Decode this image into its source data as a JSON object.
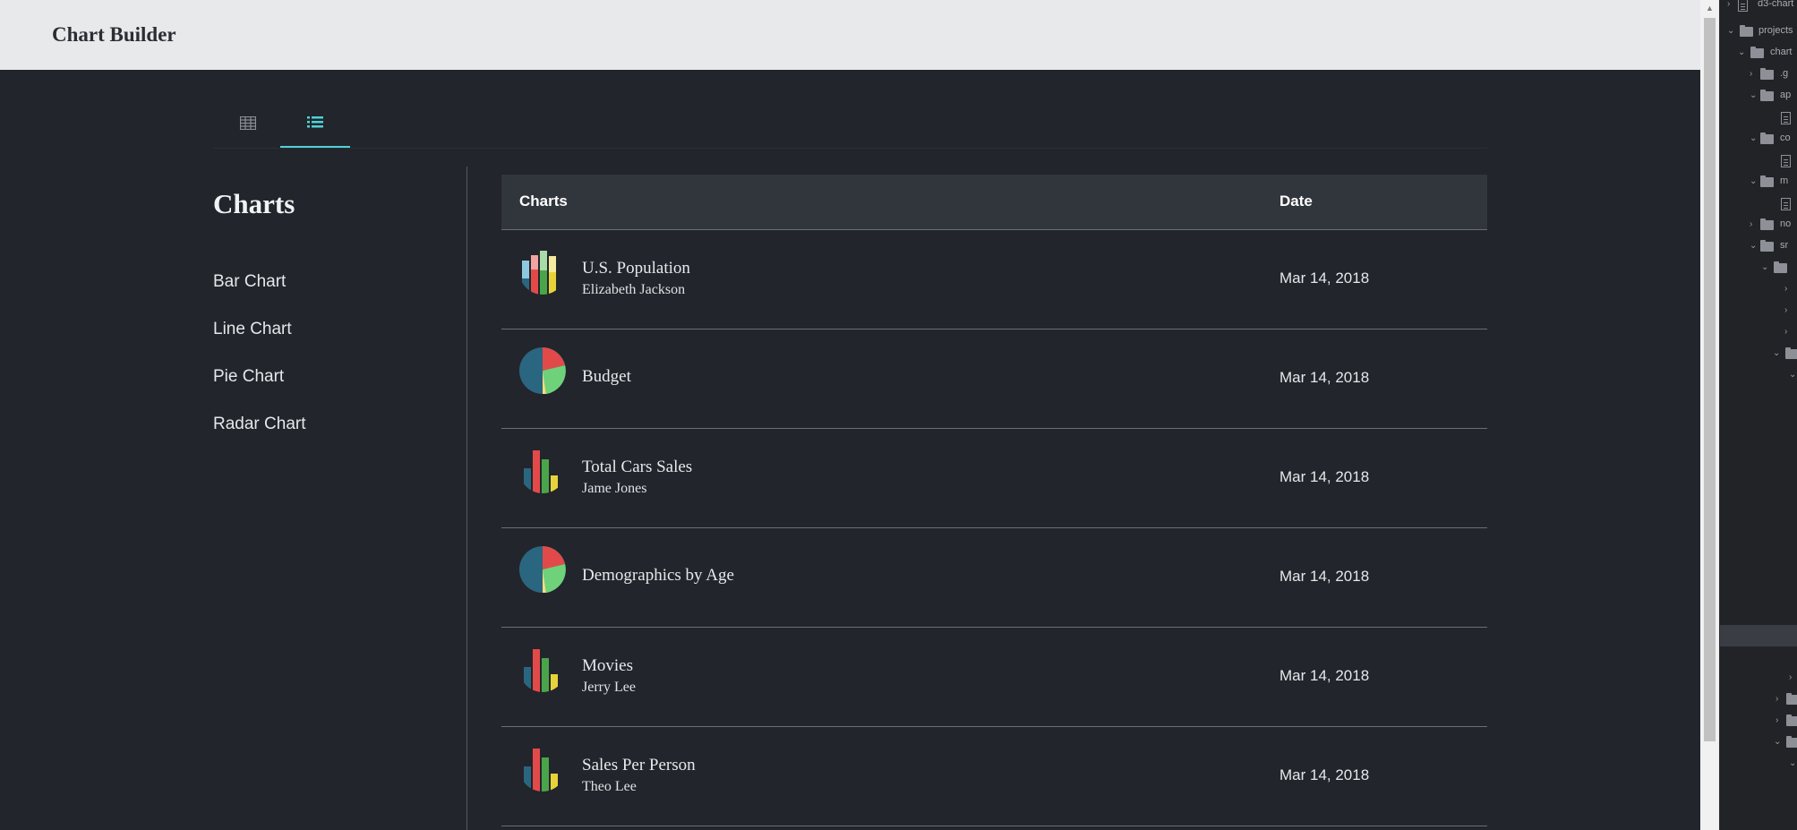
{
  "app": {
    "title": "Chart Builder"
  },
  "view_tabs": [
    {
      "icon": "table-grid-icon",
      "active": false
    },
    {
      "icon": "list-icon",
      "active": true
    }
  ],
  "accent_color": "#4fd1d9",
  "sidebar": {
    "title": "Charts",
    "items": [
      {
        "label": "Bar Chart"
      },
      {
        "label": "Line Chart"
      },
      {
        "label": "Pie Chart"
      },
      {
        "label": "Radar Chart"
      }
    ]
  },
  "table": {
    "headers": {
      "name": "Charts",
      "date": "Date"
    },
    "rows": [
      {
        "icon": "bar-chart-icon",
        "name": "U.S. Population",
        "author": "Elizabeth Jackson",
        "date": "Mar 14, 2018"
      },
      {
        "icon": "pie-chart-icon",
        "name": "Budget",
        "author": "",
        "date": "Mar 14, 2018"
      },
      {
        "icon": "bar-chart-icon",
        "name": "Total Cars Sales",
        "author": "Jame Jones",
        "date": "Mar 14, 2018"
      },
      {
        "icon": "pie-chart-icon",
        "name": "Demographics by Age",
        "author": "",
        "date": "Mar 14, 2018"
      },
      {
        "icon": "bar-chart-icon",
        "name": "Movies",
        "author": "Jerry Lee",
        "date": "Mar 14, 2018"
      },
      {
        "icon": "bar-chart-icon",
        "name": "Sales Per Person",
        "author": "Theo Lee",
        "date": "Mar 14, 2018"
      }
    ]
  },
  "ide_tree": [
    {
      "label": "d3-chart",
      "kind": "project"
    },
    {
      "label": "projects",
      "kind": "folder"
    },
    {
      "label": "chart",
      "kind": "folder"
    },
    {
      "label": ".g",
      "kind": "folder"
    },
    {
      "label": "ap",
      "kind": "folder"
    },
    {
      "label": "",
      "kind": "file"
    },
    {
      "label": "co",
      "kind": "folder"
    },
    {
      "label": "",
      "kind": "file"
    },
    {
      "label": "m",
      "kind": "folder"
    },
    {
      "label": "",
      "kind": "file"
    },
    {
      "label": "no",
      "kind": "folder"
    },
    {
      "label": "sr",
      "kind": "folder"
    }
  ]
}
